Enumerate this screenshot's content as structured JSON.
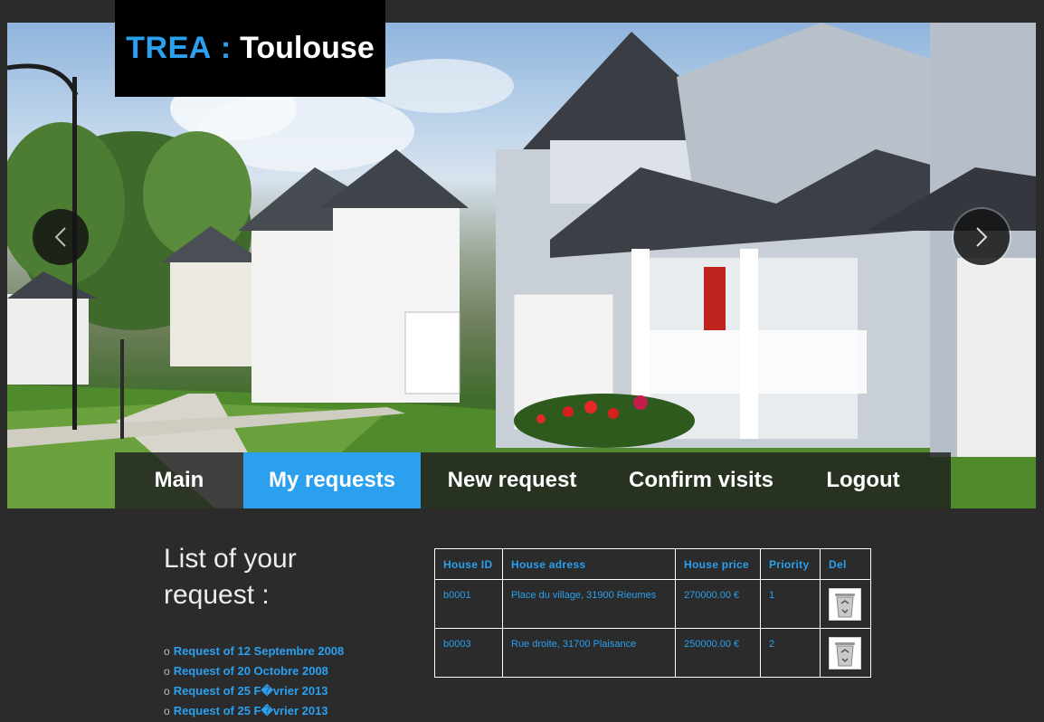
{
  "logo": {
    "brand": "TREA",
    "separator": ":",
    "city": "Toulouse"
  },
  "slider": {
    "prev_icon": "chevron-left-icon",
    "next_icon": "chevron-right-icon"
  },
  "nav": {
    "items": [
      "Main",
      "My requests",
      "New request",
      "Confirm visits",
      "Logout"
    ],
    "active": "My requests"
  },
  "sidebar": {
    "heading": "List of your request :",
    "bullet": "o",
    "requests": [
      "Request of 12 Septembre 2008",
      "Request of 20 Octobre 2008",
      "Request of 25 F�vrier 2013",
      "Request of 25 F�vrier 2013"
    ]
  },
  "table": {
    "headers": [
      "House ID",
      "House adress",
      "House price",
      "Priority",
      "Del"
    ],
    "rows": [
      {
        "id": "b0001",
        "address": "Place du village, 31900 Rieumes",
        "price": "270000.00 €",
        "priority": "1",
        "del_icon": "recycle-bin-icon"
      },
      {
        "id": "b0003",
        "address": "Rue droite, 31700 Plaisance",
        "price": "250000.00 €",
        "priority": "2",
        "del_icon": "recycle-bin-icon"
      }
    ]
  },
  "colors": {
    "accent": "#2aa0ef",
    "background": "#2b2b2b",
    "logo_bg": "#000000",
    "text_light": "#ececec"
  }
}
